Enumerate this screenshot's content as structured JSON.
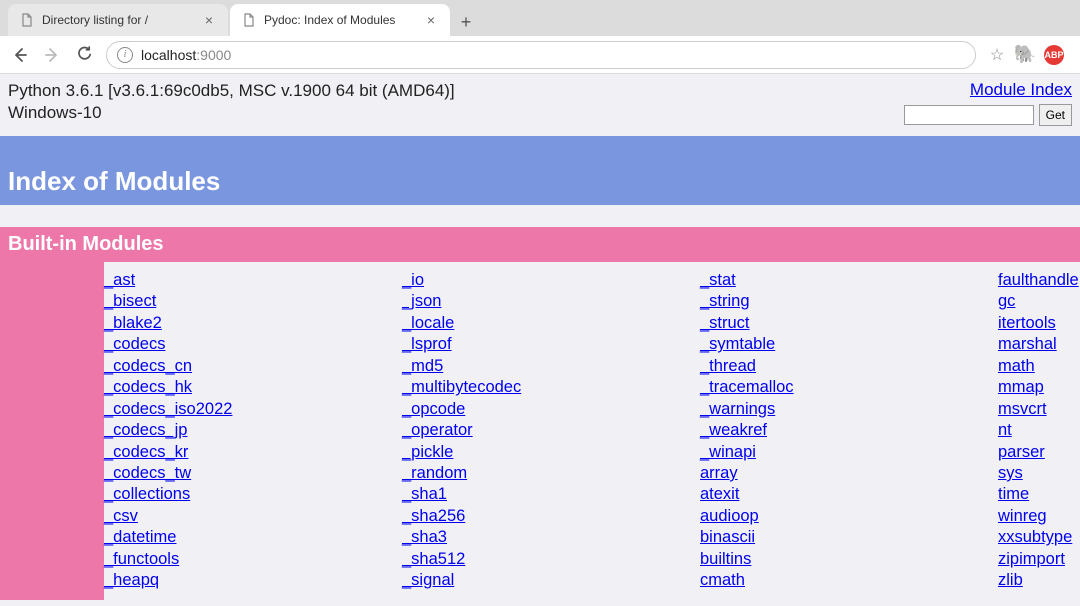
{
  "browser": {
    "tabs": [
      {
        "title": "Directory listing for /",
        "active": false
      },
      {
        "title": "Pydoc: Index of Modules",
        "active": true
      }
    ],
    "url_host": "localhost",
    "url_port": ":9000"
  },
  "info": {
    "version_line": "Python 3.6.1 [v3.6.1:69c0db5, MSC v.1900 64 bit (AMD64)]",
    "platform_line": "Windows-10",
    "module_index_link": "Module Index",
    "get_button": "Get"
  },
  "headers": {
    "index": "Index of Modules",
    "builtin": "Built-in Modules"
  },
  "modules": {
    "col1": [
      "_ast",
      "_bisect",
      "_blake2",
      "_codecs",
      "_codecs_cn",
      "_codecs_hk",
      "_codecs_iso2022",
      "_codecs_jp",
      "_codecs_kr",
      "_codecs_tw",
      "_collections",
      "_csv",
      "_datetime",
      "_functools",
      "_heapq"
    ],
    "col2": [
      "_io",
      "_json",
      "_locale",
      "_lsprof",
      "_md5",
      "_multibytecodec",
      "_opcode",
      "_operator",
      "_pickle",
      "_random",
      "_sha1",
      "_sha256",
      "_sha3",
      "_sha512",
      "_signal"
    ],
    "col3": [
      "_stat",
      "_string",
      "_struct",
      "_symtable",
      "_thread",
      "_tracemalloc",
      "_warnings",
      "_weakref",
      "_winapi",
      "array",
      "atexit",
      "audioop",
      "binascii",
      "builtins",
      "cmath"
    ],
    "col4": [
      "faulthandle",
      "gc",
      "itertools",
      "marshal",
      "math",
      "mmap",
      "msvcrt",
      "nt",
      "parser",
      "sys",
      "time",
      "winreg",
      "xxsubtype",
      "zipimport",
      "zlib"
    ]
  }
}
